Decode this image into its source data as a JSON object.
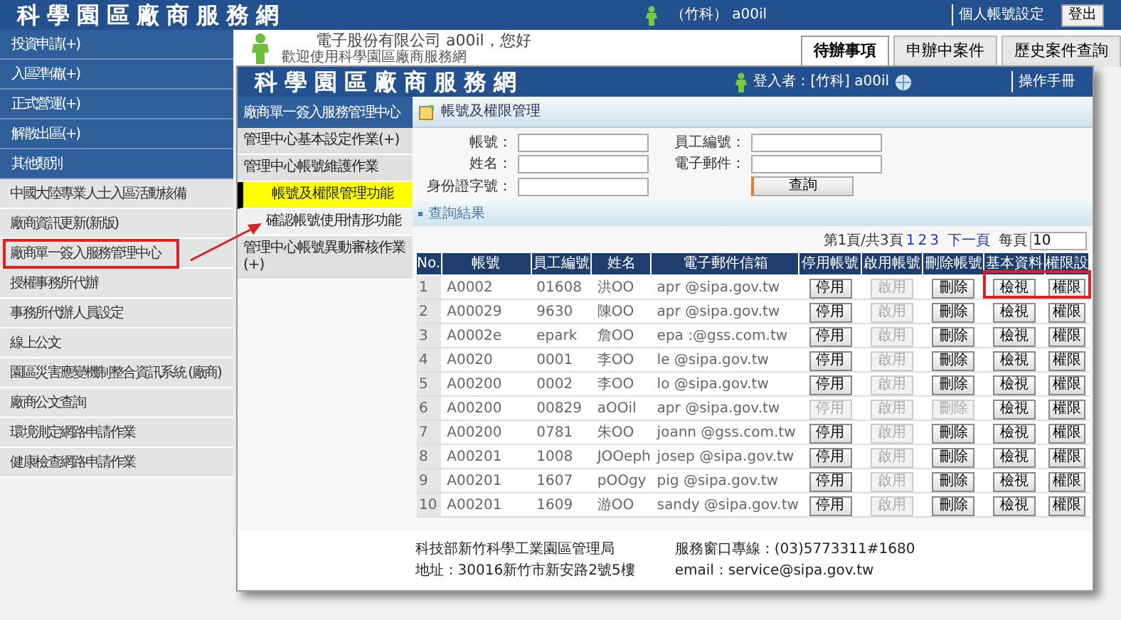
{
  "header": {
    "title": "科學園區廠商服務網",
    "user": "（竹科） a00il",
    "links": [
      "個人帳號設定"
    ],
    "logout": "登出"
  },
  "sidebar": {
    "items": [
      {
        "label": "投資申請(+)",
        "kind": "category"
      },
      {
        "label": "入區準備(+)",
        "kind": "category"
      },
      {
        "label": "正式營運(+)",
        "kind": "category"
      },
      {
        "label": "解散出區(+)",
        "kind": "category"
      },
      {
        "label": "其他類別",
        "kind": "category"
      },
      {
        "label": "中國大陸專業人士入區活動核備",
        "kind": "item"
      },
      {
        "label": "廠商資訊更新(新版)",
        "kind": "item"
      },
      {
        "label": "廠商單一簽入服務管理中心",
        "kind": "item"
      },
      {
        "label": "授權事務所代辦",
        "kind": "item"
      },
      {
        "label": "事務所代辦人員設定",
        "kind": "item"
      },
      {
        "label": "線上公文",
        "kind": "item"
      },
      {
        "label": "園區災害應變機制整合資訊系統 (廠商)",
        "kind": "item"
      },
      {
        "label": "廠商公文查詢",
        "kind": "item"
      },
      {
        "label": "環境測定網路申請作業",
        "kind": "item"
      },
      {
        "label": "健康檢查網路申請作業",
        "kind": "item"
      }
    ]
  },
  "welcome": {
    "company": "電子股份有限公司 a00il，您好",
    "message": "歡迎使用科學園區廠商服務網"
  },
  "tabs": [
    {
      "label": "待辦事項",
      "selected": true
    },
    {
      "label": "申辦中案件",
      "selected": false
    },
    {
      "label": "歷史案件查詢",
      "selected": false
    }
  ],
  "inner_window": {
    "title": "科學園區廠商服務網",
    "login": "登入者：[竹科] a00il",
    "manual": "操作手冊",
    "menu": {
      "header": "廠商單一簽入服務管理中心",
      "items": [
        {
          "label": "管理中心基本設定作業(+)",
          "kind": "group",
          "selected": false
        },
        {
          "label": "管理中心帳號維護作業",
          "kind": "group",
          "selected": false
        },
        {
          "label": "帳號及權限管理功能",
          "kind": "sub",
          "selected": true
        },
        {
          "label": "確認帳號使用情形功能",
          "kind": "sub",
          "selected": false
        },
        {
          "label": "管理中心帳號異動審核作業(+)",
          "kind": "group",
          "selected": false
        }
      ]
    },
    "panel_title": "帳號及權限管理",
    "search_form": {
      "fields": [
        {
          "label": "帳號："
        },
        {
          "label": "員工編號："
        },
        {
          "label": "姓名："
        },
        {
          "label": "電子郵件："
        },
        {
          "label": "身份證字號："
        }
      ],
      "button": "查詢"
    },
    "results_title": "查詢結果",
    "pager": {
      "info": "第1頁/共3頁",
      "pages": [
        "1",
        "2",
        "3"
      ],
      "next": "下一頁",
      "per_page_label": "每頁",
      "per_page": "10"
    },
    "table": {
      "columns": [
        "No.",
        "帳號",
        "員工編號",
        "姓名",
        "電子郵件信箱",
        "停用帳號",
        "啟用帳號",
        "刪除帳號",
        "基本資料",
        "權限設"
      ],
      "rows": [
        {
          "no": "1",
          "account": "A0002",
          "employee_id": "01608",
          "name": "洪OO",
          "email": "apr @sipa.gov.tw",
          "suspend": {
            "label": "停用",
            "disabled": false
          },
          "enable": {
            "label": "啟用",
            "disabled": true
          },
          "delete": {
            "label": "刪除",
            "disabled": false
          },
          "view": "檢視",
          "permission": "權限"
        },
        {
          "no": "2",
          "account": "A00029",
          "employee_id": "9630",
          "name": "陳OO",
          "email": "apr @sipa.gov.tw",
          "suspend": {
            "label": "停用",
            "disabled": false
          },
          "enable": {
            "label": "啟用",
            "disabled": true
          },
          "delete": {
            "label": "刪除",
            "disabled": false
          },
          "view": "檢視",
          "permission": "權限"
        },
        {
          "no": "3",
          "account": "A0002e",
          "employee_id": "epark",
          "name": "詹OO",
          "email": "epa :@gss.com.tw",
          "suspend": {
            "label": "停用",
            "disabled": false
          },
          "enable": {
            "label": "啟用",
            "disabled": true
          },
          "delete": {
            "label": "刪除",
            "disabled": false
          },
          "view": "檢視",
          "permission": "權限"
        },
        {
          "no": "4",
          "account": "A0020",
          "employee_id": "0001",
          "name": "李OO",
          "email": "le @sipa.gov.tw",
          "suspend": {
            "label": "停用",
            "disabled": false
          },
          "enable": {
            "label": "啟用",
            "disabled": true
          },
          "delete": {
            "label": "刪除",
            "disabled": false
          },
          "view": "檢視",
          "permission": "權限"
        },
        {
          "no": "5",
          "account": "A00200",
          "employee_id": "0002",
          "name": "李OO",
          "email": "lo @sipa.gov.tw",
          "suspend": {
            "label": "停用",
            "disabled": false
          },
          "enable": {
            "label": "啟用",
            "disabled": true
          },
          "delete": {
            "label": "刪除",
            "disabled": false
          },
          "view": "檢視",
          "permission": "權限"
        },
        {
          "no": "6",
          "account": "A00200",
          "employee_id": "00829",
          "name": "aOOil",
          "email": "apr @sipa.gov.tw",
          "suspend": {
            "label": "停用",
            "disabled": true
          },
          "enable": {
            "label": "啟用",
            "disabled": true
          },
          "delete": {
            "label": "刪除",
            "disabled": true
          },
          "view": "檢視",
          "permission": "權限"
        },
        {
          "no": "7",
          "account": "A00200",
          "employee_id": "0781",
          "name": "朱OO",
          "email": "joann @gss.com.tw",
          "suspend": {
            "label": "停用",
            "disabled": false
          },
          "enable": {
            "label": "啟用",
            "disabled": true
          },
          "delete": {
            "label": "刪除",
            "disabled": false
          },
          "view": "檢視",
          "permission": "權限"
        },
        {
          "no": "8",
          "account": "A00201",
          "employee_id": "1008",
          "name": "JOOeph",
          "email": "josep @sipa.gov.tw",
          "suspend": {
            "label": "停用",
            "disabled": false
          },
          "enable": {
            "label": "啟用",
            "disabled": true
          },
          "delete": {
            "label": "刪除",
            "disabled": false
          },
          "view": "檢視",
          "permission": "權限"
        },
        {
          "no": "9",
          "account": "A00201",
          "employee_id": "1607",
          "name": "pOOgy",
          "email": "pig @sipa.gov.tw",
          "suspend": {
            "label": "停用",
            "disabled": false
          },
          "enable": {
            "label": "啟用",
            "disabled": true
          },
          "delete": {
            "label": "刪除",
            "disabled": false
          },
          "view": "檢視",
          "permission": "權限"
        },
        {
          "no": "10",
          "account": "A00201",
          "employee_id": "1609",
          "name": "游OO",
          "email": "sandy @sipa.gov.tw",
          "suspend": {
            "label": "停用",
            "disabled": false
          },
          "enable": {
            "label": "啟用",
            "disabled": true
          },
          "delete": {
            "label": "刪除",
            "disabled": false
          },
          "view": "檢視",
          "permission": "權限"
        }
      ]
    },
    "footer": {
      "org": "科技部新竹科學工業園區管理局",
      "address": "地址：30016新竹市新安路2號5樓",
      "phone": "服務窗口專線：(03)5773311#1680",
      "email": "email：service@sipa.gov.tw"
    }
  }
}
